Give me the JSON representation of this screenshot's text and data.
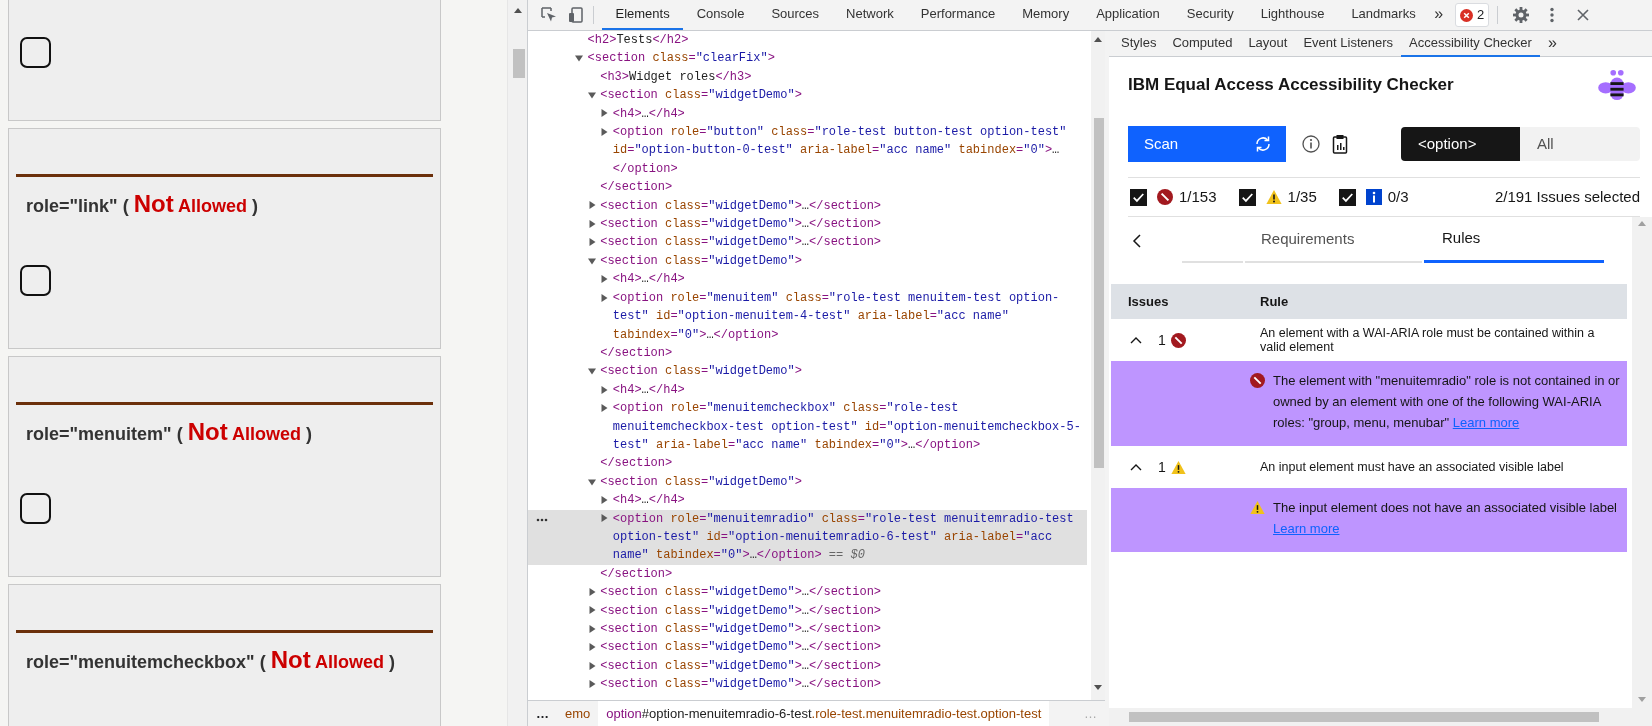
{
  "page": {
    "cards": [
      {
        "checkbox": {
          "checked": false
        }
      },
      {
        "heading_parts": [
          {
            "kind": "role",
            "text": "role=\"link\""
          },
          {
            "kind": "paren",
            "text": "("
          },
          {
            "kind": "verdict-lead",
            "text": "Not"
          },
          {
            "kind": "verdict",
            "text": "Allowed"
          },
          {
            "kind": "paren",
            "text": ")"
          }
        ],
        "checkbox": {
          "checked": false
        }
      },
      {
        "heading_parts": [
          {
            "kind": "role",
            "text": "role=\"menuitem\""
          },
          {
            "kind": "paren",
            "text": "("
          },
          {
            "kind": "verdict-lead",
            "text": "Not"
          },
          {
            "kind": "verdict",
            "text": "Allowed"
          },
          {
            "kind": "paren",
            "text": ")"
          }
        ],
        "checkbox": {
          "checked": false
        }
      },
      {
        "heading_parts": [
          {
            "kind": "role",
            "text": "role=\"menuitemcheckbox\""
          },
          {
            "kind": "paren",
            "text": "("
          },
          {
            "kind": "verdict-lead",
            "text": "Not"
          },
          {
            "kind": "verdict",
            "text": "Allowed"
          },
          {
            "kind": "paren",
            "text": ")"
          }
        ]
      }
    ]
  },
  "devtools": {
    "toolbar": {
      "tabs": [
        {
          "label": "Elements",
          "selected": true
        },
        {
          "label": "Console",
          "selected": false
        },
        {
          "label": "Sources",
          "selected": false
        },
        {
          "label": "Network",
          "selected": false
        },
        {
          "label": "Performance",
          "selected": false
        },
        {
          "label": "Memory",
          "selected": false
        },
        {
          "label": "Application",
          "selected": false
        },
        {
          "label": "Security",
          "selected": false
        },
        {
          "label": "Lighthouse",
          "selected": false
        },
        {
          "label": "Landmarks",
          "selected": false
        }
      ],
      "more": "»",
      "error_count": "2"
    },
    "elements": {
      "tree": [
        {
          "markup": "<h2>Tests</h2>",
          "selected": false
        },
        {
          "markup": "<section class=\"clearFix\">",
          "expanded": true,
          "selected": false,
          "children": [
            {
              "markup": "<h3>Widget roles</h3>",
              "selected": false
            },
            {
              "markup": "<section class=\"widgetDemo\">",
              "expanded": true,
              "selected": false,
              "close": "</section>",
              "children": [
                {
                  "markup": "<h4>…</h4>",
                  "expanded": false,
                  "selected": false
                },
                {
                  "markup": "<option role=\"button\" class=\"role-test button-test option-test\" id=\"option-button-0-test\" aria-label=\"acc name\" tabindex=\"0\">…</option>",
                  "expanded": false,
                  "selected": false
                }
              ]
            },
            {
              "markup": "<section class=\"widgetDemo\">…</section>",
              "expanded": false,
              "selected": false
            },
            {
              "markup": "<section class=\"widgetDemo\">…</section>",
              "expanded": false,
              "selected": false
            },
            {
              "markup": "<section class=\"widgetDemo\">…</section>",
              "expanded": false,
              "selected": false
            },
            {
              "markup": "<section class=\"widgetDemo\">",
              "expanded": true,
              "selected": false,
              "close": "</section>",
              "children": [
                {
                  "markup": "<h4>…</h4>",
                  "expanded": false,
                  "selected": false
                },
                {
                  "markup": "<option role=\"menuitem\" class=\"role-test menuitem-test option-test\" id=\"option-menuitem-4-test\" aria-label=\"acc name\" tabindex=\"0\">…</option>",
                  "expanded": false,
                  "selected": false
                }
              ]
            },
            {
              "markup": "<section class=\"widgetDemo\">",
              "expanded": true,
              "selected": false,
              "close": "</section>",
              "children": [
                {
                  "markup": "<h4>…</h4>",
                  "expanded": false,
                  "selected": false
                },
                {
                  "markup": "<option role=\"menuitemcheckbox\" class=\"role-test menuitemcheckbox-test option-test\" id=\"option-menuitemcheckbox-5-test\" aria-label=\"acc name\" tabindex=\"0\">…</option>",
                  "expanded": false,
                  "selected": false
                }
              ]
            },
            {
              "markup": "<section class=\"widgetDemo\">",
              "expanded": true,
              "selected": false,
              "close": "</section>",
              "children": [
                {
                  "markup": "<h4>…</h4>",
                  "expanded": false,
                  "selected": false
                },
                {
                  "markup": "<option role=\"menuitemradio\" class=\"role-test menuitemradio-test option-test\" id=\"option-menuitemradio-6-test\" aria-label=\"acc name\" tabindex=\"0\">…</option>",
                  "expanded": false,
                  "selected": true,
                  "suffix": "== $0"
                }
              ]
            },
            {
              "markup": "<section class=\"widgetDemo\">…</section>",
              "expanded": false,
              "selected": false
            },
            {
              "markup": "<section class=\"widgetDemo\">…</section>",
              "expanded": false,
              "selected": false
            },
            {
              "markup": "<section class=\"widgetDemo\">…</section>",
              "expanded": false,
              "selected": false
            },
            {
              "markup": "<section class=\"widgetDemo\">…</section>",
              "expanded": false,
              "selected": false
            },
            {
              "markup": "<section class=\"widgetDemo\">…</section>",
              "expanded": false,
              "selected": false
            },
            {
              "markup": "<section class=\"widgetDemo\">…</section>",
              "expanded": false,
              "selected": false
            }
          ]
        }
      ],
      "breadcrumbs": {
        "overflow_left": "…",
        "overflow_right": "…",
        "items": [
          {
            "kind": "partial",
            "text": "emo",
            "selected": false
          },
          {
            "kind": "node",
            "tag": "option",
            "id": "#option-menuitemradio-6-test",
            "classes": ".role-test.menuitemradio-test.option-test",
            "selected": true
          }
        ]
      }
    },
    "sidebar": {
      "tabs": [
        {
          "label": "Styles",
          "selected": false
        },
        {
          "label": "Computed",
          "selected": false
        },
        {
          "label": "Layout",
          "selected": false
        },
        {
          "label": "Event Listeners",
          "selected": false
        },
        {
          "label": "Accessibility Checker",
          "selected": true
        }
      ],
      "more": "»",
      "checker": {
        "title": "IBM Equal Access Accessibility Checker",
        "scan_label": "Scan",
        "scope": [
          {
            "label": "<option>",
            "selected": true
          },
          {
            "label": "All",
            "selected": false
          }
        ],
        "filters": [
          {
            "kind": "violation",
            "checked": true,
            "count": "1/153"
          },
          {
            "kind": "warning",
            "checked": true,
            "count": "1/35"
          },
          {
            "kind": "info",
            "checked": true,
            "count": "0/3"
          }
        ],
        "selection_summary": "2/191 Issues selected",
        "view_tabs": [
          {
            "label": "Requirements",
            "selected": false
          },
          {
            "label": "Rules",
            "selected": true
          }
        ],
        "columns": [
          "Issues",
          "Rule"
        ],
        "rules": [
          {
            "kind": "violation",
            "expanded": true,
            "count": "1",
            "rule": "An element with a WAI-ARIA role must be contained within a valid element",
            "message": "The element with \"menuitemradio\" role is not contained in or owned by an element with one of the following WAI-ARIA roles: \"group, menu, menubar\"",
            "link": "Learn more"
          },
          {
            "kind": "warning",
            "expanded": true,
            "count": "1",
            "rule": "An input element must have an associated visible label",
            "message": "The input element does not have an associated visible label",
            "link": "Learn more"
          }
        ]
      }
    }
  }
}
